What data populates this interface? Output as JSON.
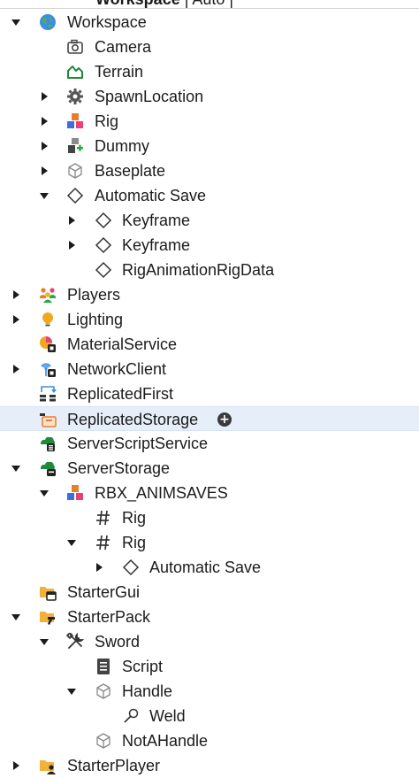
{
  "header": {
    "title_bold": "Workspace",
    "title_rest": " | Auto | "
  },
  "tree": {
    "rows": [
      {
        "label": "Workspace",
        "arrow": "down",
        "icon": "globe-icon"
      },
      {
        "label": "Camera",
        "arrow": "none",
        "icon": "camera-icon"
      },
      {
        "label": "Terrain",
        "arrow": "none",
        "icon": "terrain-icon"
      },
      {
        "label": "SpawnLocation",
        "arrow": "right",
        "icon": "gear-icon"
      },
      {
        "label": "Rig",
        "arrow": "right",
        "icon": "model-icon"
      },
      {
        "label": "Dummy",
        "arrow": "right",
        "icon": "model-add-icon"
      },
      {
        "label": "Baseplate",
        "arrow": "right",
        "icon": "part-cube-icon"
      },
      {
        "label": "Automatic Save",
        "arrow": "down",
        "icon": "diamond-icon"
      },
      {
        "label": "Keyframe",
        "arrow": "right",
        "icon": "diamond-icon"
      },
      {
        "label": "Keyframe",
        "arrow": "right",
        "icon": "diamond-icon"
      },
      {
        "label": "RigAnimationRigData",
        "arrow": "none",
        "icon": "diamond-icon"
      },
      {
        "label": "Players",
        "arrow": "right",
        "icon": "players-icon"
      },
      {
        "label": "Lighting",
        "arrow": "right",
        "icon": "lightbulb-icon"
      },
      {
        "label": "MaterialService",
        "arrow": "none",
        "icon": "material-service-icon"
      },
      {
        "label": "NetworkClient",
        "arrow": "right",
        "icon": "network-icon"
      },
      {
        "label": "ReplicatedFirst",
        "arrow": "none",
        "icon": "replicated-first-icon"
      },
      {
        "label": "ReplicatedStorage",
        "arrow": "none",
        "icon": "replicated-storage-icon"
      },
      {
        "label": "ServerScriptService",
        "arrow": "none",
        "icon": "server-script-service-icon"
      },
      {
        "label": "ServerStorage",
        "arrow": "down",
        "icon": "server-storage-icon"
      },
      {
        "label": "RBX_ANIMSAVES",
        "arrow": "down",
        "icon": "model-icon"
      },
      {
        "label": "Rig",
        "arrow": "none",
        "icon": "hash-icon"
      },
      {
        "label": "Rig",
        "arrow": "down",
        "icon": "hash-icon"
      },
      {
        "label": "Automatic Save",
        "arrow": "right",
        "icon": "diamond-icon"
      },
      {
        "label": "StarterGui",
        "arrow": "none",
        "icon": "starter-gui-icon"
      },
      {
        "label": "StarterPack",
        "arrow": "down",
        "icon": "starter-pack-icon"
      },
      {
        "label": "Sword",
        "arrow": "down",
        "icon": "tool-icon"
      },
      {
        "label": "Script",
        "arrow": "none",
        "icon": "script-icon"
      },
      {
        "label": "Handle",
        "arrow": "down",
        "icon": "part-cube-icon"
      },
      {
        "label": "Weld",
        "arrow": "none",
        "icon": "weld-icon"
      },
      {
        "label": "NotAHandle",
        "arrow": "none",
        "icon": "part-cube-icon"
      },
      {
        "label": "StarterPlayer",
        "arrow": "right",
        "icon": "starter-player-icon"
      }
    ]
  }
}
